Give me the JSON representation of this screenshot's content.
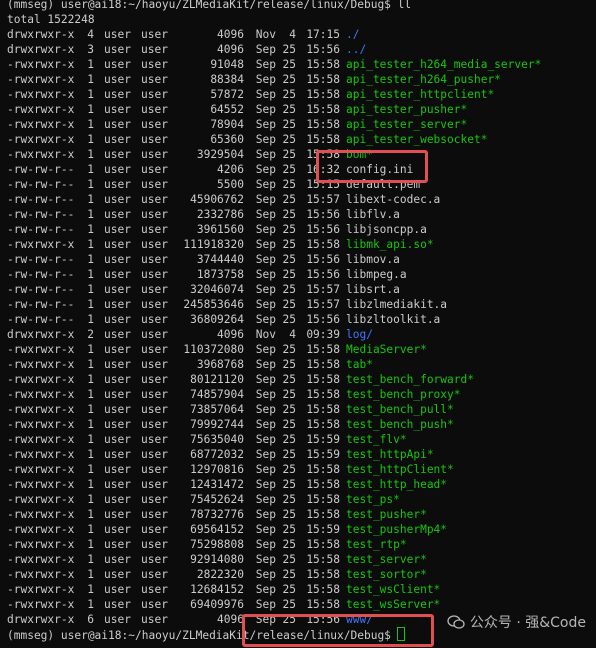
{
  "terminal": {
    "top_prompt": "(mmseg) user@ai18:~/haoyu/ZLMediaKit/release/linux/Debug$ ll",
    "total": "total 1522248",
    "entries": [
      {
        "perm": "drwxrwxr-x",
        "links": "4",
        "owner": "user",
        "group": "user",
        "size": "4096",
        "month": "Nov",
        "day": "4",
        "time": "17:15",
        "name": "./",
        "type": "dir"
      },
      {
        "perm": "drwxrwxr-x",
        "links": "3",
        "owner": "user",
        "group": "user",
        "size": "4096",
        "month": "Sep",
        "day": "25",
        "time": "15:56",
        "name": "../",
        "type": "dir"
      },
      {
        "perm": "-rwxrwxr-x",
        "links": "1",
        "owner": "user",
        "group": "user",
        "size": "91048",
        "month": "Sep",
        "day": "25",
        "time": "15:58",
        "name": "api_tester_h264_media_server*",
        "type": "exec"
      },
      {
        "perm": "-rwxrwxr-x",
        "links": "1",
        "owner": "user",
        "group": "user",
        "size": "88384",
        "month": "Sep",
        "day": "25",
        "time": "15:58",
        "name": "api_tester_h264_pusher*",
        "type": "exec"
      },
      {
        "perm": "-rwxrwxr-x",
        "links": "1",
        "owner": "user",
        "group": "user",
        "size": "57872",
        "month": "Sep",
        "day": "25",
        "time": "15:58",
        "name": "api_tester_httpclient*",
        "type": "exec"
      },
      {
        "perm": "-rwxrwxr-x",
        "links": "1",
        "owner": "user",
        "group": "user",
        "size": "64552",
        "month": "Sep",
        "day": "25",
        "time": "15:58",
        "name": "api_tester_pusher*",
        "type": "exec"
      },
      {
        "perm": "-rwxrwxr-x",
        "links": "1",
        "owner": "user",
        "group": "user",
        "size": "78904",
        "month": "Sep",
        "day": "25",
        "time": "15:58",
        "name": "api_tester_server*",
        "type": "exec"
      },
      {
        "perm": "-rwxrwxr-x",
        "links": "1",
        "owner": "user",
        "group": "user",
        "size": "65360",
        "month": "Sep",
        "day": "25",
        "time": "15:58",
        "name": "api_tester_websocket*",
        "type": "exec"
      },
      {
        "perm": "-rwxrwxr-x",
        "links": "1",
        "owner": "user",
        "group": "user",
        "size": "3929504",
        "month": "Sep",
        "day": "25",
        "time": "15:58",
        "name": "bom*",
        "type": "exec"
      },
      {
        "perm": "-rw-rw-r--",
        "links": "1",
        "owner": "user",
        "group": "user",
        "size": "4206",
        "month": "Sep",
        "day": "25",
        "time": "16:32",
        "name": "config.ini",
        "type": "plain"
      },
      {
        "perm": "-rw-rw-r--",
        "links": "1",
        "owner": "user",
        "group": "user",
        "size": "5500",
        "month": "Sep",
        "day": "25",
        "time": "15:15",
        "name": "default.pem",
        "type": "plain"
      },
      {
        "perm": "-rw-rw-r--",
        "links": "1",
        "owner": "user",
        "group": "user",
        "size": "45906762",
        "month": "Sep",
        "day": "25",
        "time": "15:57",
        "name": "libext-codec.a",
        "type": "plain"
      },
      {
        "perm": "-rw-rw-r--",
        "links": "1",
        "owner": "user",
        "group": "user",
        "size": "2332786",
        "month": "Sep",
        "day": "25",
        "time": "15:56",
        "name": "libflv.a",
        "type": "plain"
      },
      {
        "perm": "-rw-rw-r--",
        "links": "1",
        "owner": "user",
        "group": "user",
        "size": "3961560",
        "month": "Sep",
        "day": "25",
        "time": "15:56",
        "name": "libjsoncpp.a",
        "type": "plain"
      },
      {
        "perm": "-rwxrwxr-x",
        "links": "1",
        "owner": "user",
        "group": "user",
        "size": "111918320",
        "month": "Sep",
        "day": "25",
        "time": "15:58",
        "name": "libmk_api.so*",
        "type": "exec"
      },
      {
        "perm": "-rw-rw-r--",
        "links": "1",
        "owner": "user",
        "group": "user",
        "size": "3744440",
        "month": "Sep",
        "day": "25",
        "time": "15:56",
        "name": "libmov.a",
        "type": "plain"
      },
      {
        "perm": "-rw-rw-r--",
        "links": "1",
        "owner": "user",
        "group": "user",
        "size": "1873758",
        "month": "Sep",
        "day": "25",
        "time": "15:56",
        "name": "libmpeg.a",
        "type": "plain"
      },
      {
        "perm": "-rw-rw-r--",
        "links": "1",
        "owner": "user",
        "group": "user",
        "size": "32046074",
        "month": "Sep",
        "day": "25",
        "time": "15:57",
        "name": "libsrt.a",
        "type": "plain"
      },
      {
        "perm": "-rw-rw-r--",
        "links": "1",
        "owner": "user",
        "group": "user",
        "size": "245853646",
        "month": "Sep",
        "day": "25",
        "time": "15:57",
        "name": "libzlmediakit.a",
        "type": "plain"
      },
      {
        "perm": "-rw-rw-r--",
        "links": "1",
        "owner": "user",
        "group": "user",
        "size": "36809264",
        "month": "Sep",
        "day": "25",
        "time": "15:56",
        "name": "libzltoolkit.a",
        "type": "plain"
      },
      {
        "perm": "drwxrwxr-x",
        "links": "2",
        "owner": "user",
        "group": "user",
        "size": "4096",
        "month": "Nov",
        "day": "4",
        "time": "09:39",
        "name": "log/",
        "type": "dir"
      },
      {
        "perm": "-rwxrwxr-x",
        "links": "1",
        "owner": "user",
        "group": "user",
        "size": "110372080",
        "month": "Sep",
        "day": "25",
        "time": "15:58",
        "name": "MediaServer*",
        "type": "exec"
      },
      {
        "perm": "-rwxrwxr-x",
        "links": "1",
        "owner": "user",
        "group": "user",
        "size": "3968768",
        "month": "Sep",
        "day": "25",
        "time": "15:58",
        "name": "tab*",
        "type": "exec"
      },
      {
        "perm": "-rwxrwxr-x",
        "links": "1",
        "owner": "user",
        "group": "user",
        "size": "80121120",
        "month": "Sep",
        "day": "25",
        "time": "15:58",
        "name": "test_bench_forward*",
        "type": "exec"
      },
      {
        "perm": "-rwxrwxr-x",
        "links": "1",
        "owner": "user",
        "group": "user",
        "size": "74857904",
        "month": "Sep",
        "day": "25",
        "time": "15:58",
        "name": "test_bench_proxy*",
        "type": "exec"
      },
      {
        "perm": "-rwxrwxr-x",
        "links": "1",
        "owner": "user",
        "group": "user",
        "size": "73857064",
        "month": "Sep",
        "day": "25",
        "time": "15:58",
        "name": "test_bench_pull*",
        "type": "exec"
      },
      {
        "perm": "-rwxrwxr-x",
        "links": "1",
        "owner": "user",
        "group": "user",
        "size": "79992744",
        "month": "Sep",
        "day": "25",
        "time": "15:58",
        "name": "test_bench_push*",
        "type": "exec"
      },
      {
        "perm": "-rwxrwxr-x",
        "links": "1",
        "owner": "user",
        "group": "user",
        "size": "75635040",
        "month": "Sep",
        "day": "25",
        "time": "15:59",
        "name": "test_flv*",
        "type": "exec"
      },
      {
        "perm": "-rwxrwxr-x",
        "links": "1",
        "owner": "user",
        "group": "user",
        "size": "68772032",
        "month": "Sep",
        "day": "25",
        "time": "15:59",
        "name": "test_httpApi*",
        "type": "exec"
      },
      {
        "perm": "-rwxrwxr-x",
        "links": "1",
        "owner": "user",
        "group": "user",
        "size": "12970816",
        "month": "Sep",
        "day": "25",
        "time": "15:58",
        "name": "test_httpClient*",
        "type": "exec"
      },
      {
        "perm": "-rwxrwxr-x",
        "links": "1",
        "owner": "user",
        "group": "user",
        "size": "12431472",
        "month": "Sep",
        "day": "25",
        "time": "15:58",
        "name": "test_http_head*",
        "type": "exec"
      },
      {
        "perm": "-rwxrwxr-x",
        "links": "1",
        "owner": "user",
        "group": "user",
        "size": "75452624",
        "month": "Sep",
        "day": "25",
        "time": "15:58",
        "name": "test_ps*",
        "type": "exec"
      },
      {
        "perm": "-rwxrwxr-x",
        "links": "1",
        "owner": "user",
        "group": "user",
        "size": "78732776",
        "month": "Sep",
        "day": "25",
        "time": "15:58",
        "name": "test_pusher*",
        "type": "exec"
      },
      {
        "perm": "-rwxrwxr-x",
        "links": "1",
        "owner": "user",
        "group": "user",
        "size": "69564152",
        "month": "Sep",
        "day": "25",
        "time": "15:59",
        "name": "test_pusherMp4*",
        "type": "exec"
      },
      {
        "perm": "-rwxrwxr-x",
        "links": "1",
        "owner": "user",
        "group": "user",
        "size": "75298808",
        "month": "Sep",
        "day": "25",
        "time": "15:58",
        "name": "test_rtp*",
        "type": "exec"
      },
      {
        "perm": "-rwxrwxr-x",
        "links": "1",
        "owner": "user",
        "group": "user",
        "size": "92914080",
        "month": "Sep",
        "day": "25",
        "time": "15:58",
        "name": "test_server*",
        "type": "exec"
      },
      {
        "perm": "-rwxrwxr-x",
        "links": "1",
        "owner": "user",
        "group": "user",
        "size": "2822320",
        "month": "Sep",
        "day": "25",
        "time": "15:58",
        "name": "test_sortor*",
        "type": "exec"
      },
      {
        "perm": "-rwxrwxr-x",
        "links": "1",
        "owner": "user",
        "group": "user",
        "size": "12684152",
        "month": "Sep",
        "day": "25",
        "time": "15:58",
        "name": "test_wsClient*",
        "type": "exec"
      },
      {
        "perm": "-rwxrwxr-x",
        "links": "1",
        "owner": "user",
        "group": "user",
        "size": "69409976",
        "month": "Sep",
        "day": "25",
        "time": "15:58",
        "name": "test_wsServer*",
        "type": "exec"
      },
      {
        "perm": "drwxrwxr-x",
        "links": "6",
        "owner": "user",
        "group": "user",
        "size": "4096",
        "month": "Sep",
        "day": "25",
        "time": "15:56",
        "name": "www/",
        "type": "dir"
      }
    ],
    "bottom_prompt": "(mmseg) user@ai18:~/haoyu/ZLMediaKit/release/linux/Debug$"
  },
  "watermark": {
    "text": "公众号 · 强&Code",
    "icon": "wechat-icon"
  },
  "colors": {
    "background": "#0c0c0c",
    "text": "#cccccc",
    "executable": "#16c60c",
    "directory": "#3b78ff",
    "highlight": "#e05050"
  }
}
